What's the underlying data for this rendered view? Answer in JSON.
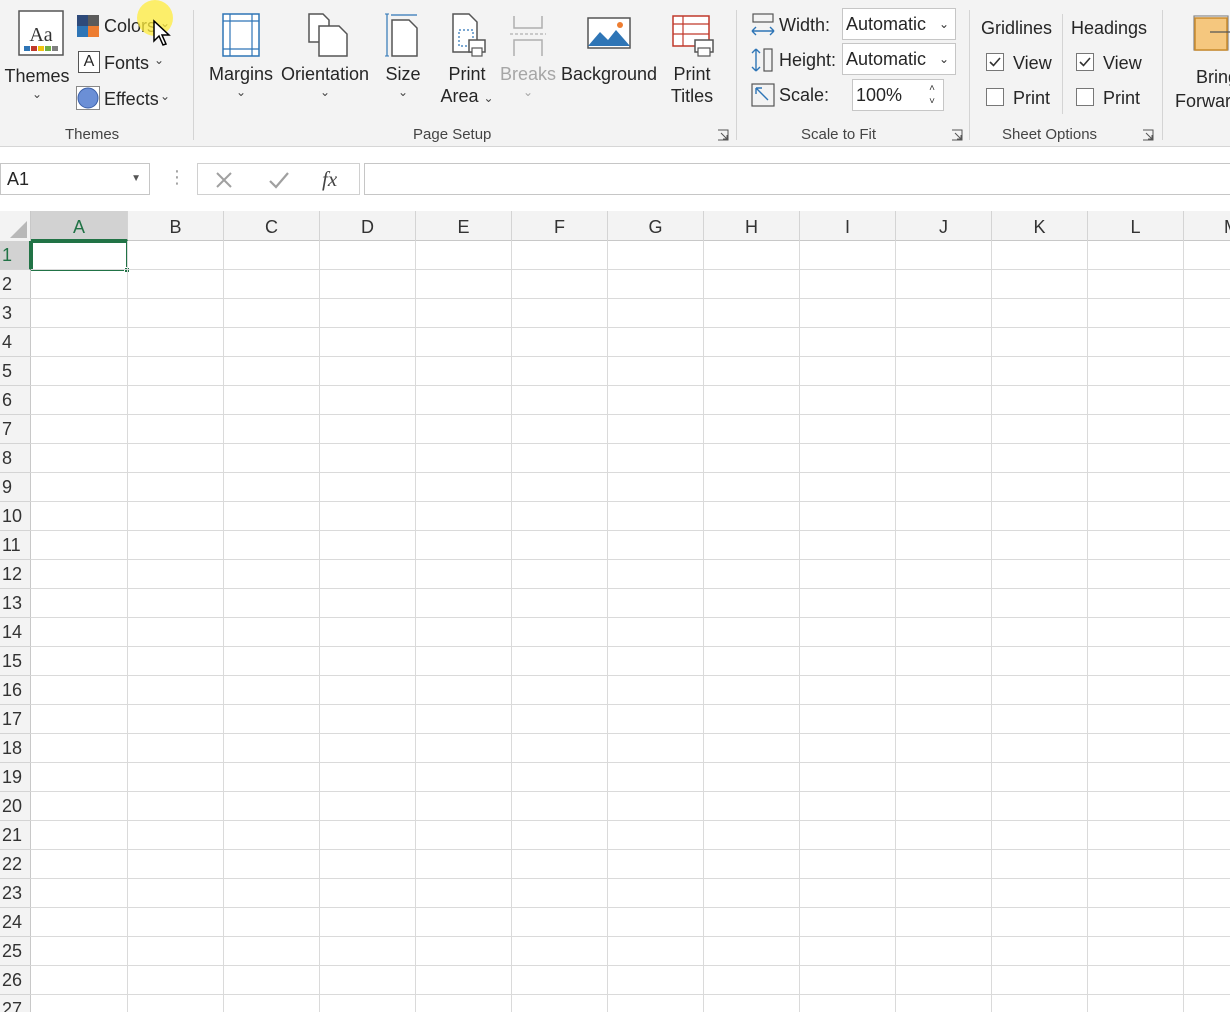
{
  "ribbon": {
    "themes_group": {
      "themes_label": "Themes",
      "colors_label": "Colors",
      "fonts_label": "Fonts",
      "effects_label": "Effects",
      "group_label": "Themes"
    },
    "page_setup_group": {
      "margins_label": "Margins",
      "orientation_label": "Orientation",
      "size_label": "Size",
      "print_area_line1": "Print",
      "print_area_line2": "Area",
      "breaks_label": "Breaks",
      "background_label": "Background",
      "print_titles_line1": "Print",
      "print_titles_line2": "Titles",
      "group_label": "Page Setup"
    },
    "scale_group": {
      "width_label": "Width:",
      "width_value": "Automatic",
      "height_label": "Height:",
      "height_value": "Automatic",
      "scale_label": "Scale:",
      "scale_value": "100%",
      "group_label": "Scale to Fit"
    },
    "sheet_options_group": {
      "gridlines_label": "Gridlines",
      "headings_label": "Headings",
      "gridlines_view_label": "View",
      "gridlines_print_label": "Print",
      "headings_view_label": "View",
      "headings_print_label": "Print",
      "gridlines_view_checked": true,
      "gridlines_print_checked": false,
      "headings_view_checked": true,
      "headings_print_checked": false,
      "group_label": "Sheet Options"
    },
    "arrange_group": {
      "bring_forward_line1": "Bring",
      "bring_forward_line2": "Forward"
    }
  },
  "formula_bar": {
    "name_box": "A1",
    "cancel_icon": "cancel-icon",
    "enter_icon": "enter-icon",
    "function_label": "fx",
    "formula_value": ""
  },
  "sheet": {
    "columns": [
      "A",
      "B",
      "C",
      "D",
      "E",
      "F",
      "G",
      "H",
      "I",
      "J",
      "K",
      "L",
      "M"
    ],
    "rows": [
      "1",
      "2",
      "3",
      "4",
      "5",
      "6",
      "7",
      "8",
      "9",
      "10",
      "11",
      "12",
      "13",
      "14",
      "15",
      "16",
      "17",
      "18",
      "19",
      "20",
      "21",
      "22",
      "23",
      "24",
      "25",
      "26",
      "27"
    ],
    "selected_cell": "A1"
  },
  "colors": {
    "accent_green": "#217346",
    "ribbon_bg": "#f3f3f3",
    "icon_blue": "#2e75b6",
    "icon_red": "#c0392b"
  }
}
